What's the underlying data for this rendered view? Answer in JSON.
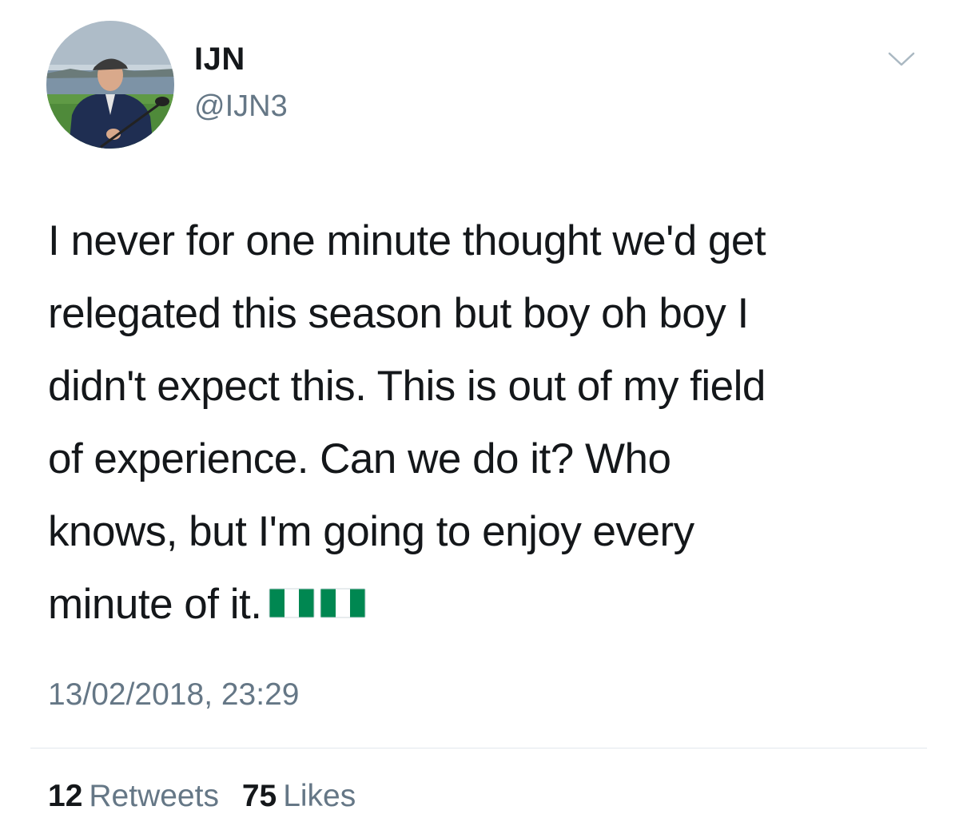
{
  "user": {
    "display_name": "IJN",
    "handle": "@IJN3",
    "avatar": "profile-photo-man-with-golf-club"
  },
  "tweet": {
    "lines": [
      "I never for one minute thought we'd get",
      "relegated this season but boy oh boy I",
      "didn't expect this. This is out of my field",
      "of experience. Can we do it? Who",
      "knows, but I'm going to enjoy every",
      "minute of it."
    ],
    "emoji": [
      "nigeria-flag-icon",
      "nigeria-flag-icon"
    ],
    "timestamp": "13/02/2018, 23:29"
  },
  "stats": {
    "retweets_count": "12",
    "retweets_label": "Retweets",
    "likes_count": "75",
    "likes_label": "Likes"
  },
  "colors": {
    "text_primary": "#14171a",
    "text_secondary": "#657786",
    "divider": "#e1e8ed",
    "flag_green": "#008751",
    "flag_white": "#ffffff"
  },
  "icons": {
    "menu": "chevron-down-icon"
  }
}
